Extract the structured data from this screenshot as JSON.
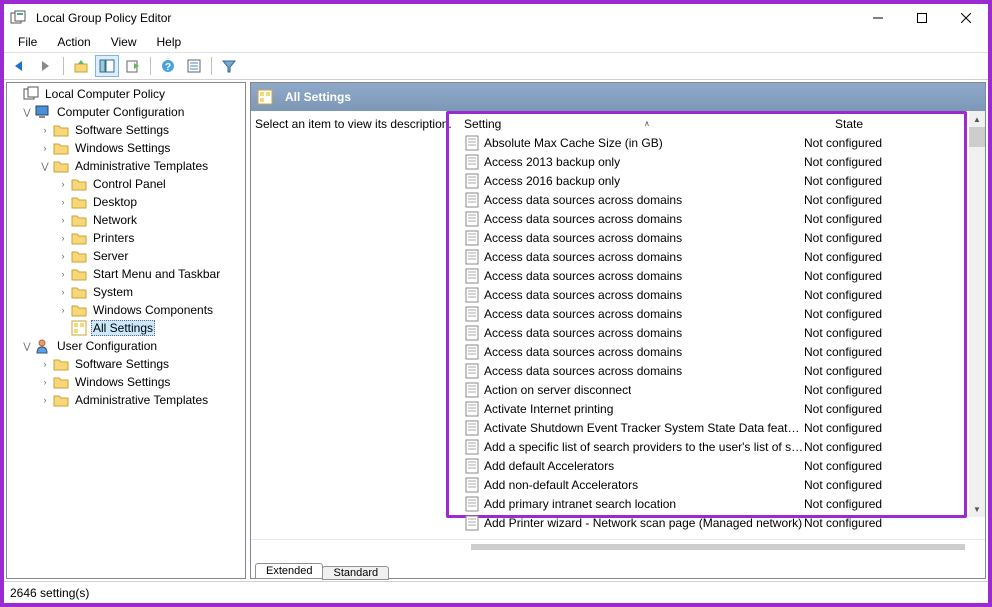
{
  "window": {
    "title": "Local Group Policy Editor"
  },
  "menubar": [
    "File",
    "Action",
    "View",
    "Help"
  ],
  "details": {
    "header": "All Settings",
    "desc_prompt": "Select an item to view its description.",
    "columns": {
      "setting": "Setting",
      "state": "State"
    }
  },
  "tabs": {
    "extended": "Extended",
    "standard": "Standard"
  },
  "statusbar": {
    "count": "2646 setting(s)"
  },
  "tree": {
    "root": "Local Computer Policy",
    "comp": "Computer Configuration",
    "comp_children": [
      "Software Settings",
      "Windows Settings",
      "Administrative Templates"
    ],
    "admin_children": [
      "Control Panel",
      "Desktop",
      "Network",
      "Printers",
      "Server",
      "Start Menu and Taskbar",
      "System",
      "Windows Components",
      "All Settings"
    ],
    "user": "User Configuration",
    "user_children": [
      "Software Settings",
      "Windows Settings",
      "Administrative Templates"
    ]
  },
  "settings": [
    {
      "name": "Absolute Max Cache Size (in GB)",
      "state": "Not configured"
    },
    {
      "name": "Access 2013 backup only",
      "state": "Not configured"
    },
    {
      "name": "Access 2016 backup only",
      "state": "Not configured"
    },
    {
      "name": "Access data sources across domains",
      "state": "Not configured"
    },
    {
      "name": "Access data sources across domains",
      "state": "Not configured"
    },
    {
      "name": "Access data sources across domains",
      "state": "Not configured"
    },
    {
      "name": "Access data sources across domains",
      "state": "Not configured"
    },
    {
      "name": "Access data sources across domains",
      "state": "Not configured"
    },
    {
      "name": "Access data sources across domains",
      "state": "Not configured"
    },
    {
      "name": "Access data sources across domains",
      "state": "Not configured"
    },
    {
      "name": "Access data sources across domains",
      "state": "Not configured"
    },
    {
      "name": "Access data sources across domains",
      "state": "Not configured"
    },
    {
      "name": "Access data sources across domains",
      "state": "Not configured"
    },
    {
      "name": "Action on server disconnect",
      "state": "Not configured"
    },
    {
      "name": "Activate Internet printing",
      "state": "Not configured"
    },
    {
      "name": "Activate Shutdown Event Tracker System State Data feature",
      "state": "Not configured"
    },
    {
      "name": "Add a specific list of search providers to the user's list of sea...",
      "state": "Not configured"
    },
    {
      "name": "Add default Accelerators",
      "state": "Not configured"
    },
    {
      "name": "Add non-default Accelerators",
      "state": "Not configured"
    },
    {
      "name": "Add primary intranet search location",
      "state": "Not configured"
    },
    {
      "name": "Add Printer wizard - Network scan page (Managed network)",
      "state": "Not configured"
    }
  ]
}
